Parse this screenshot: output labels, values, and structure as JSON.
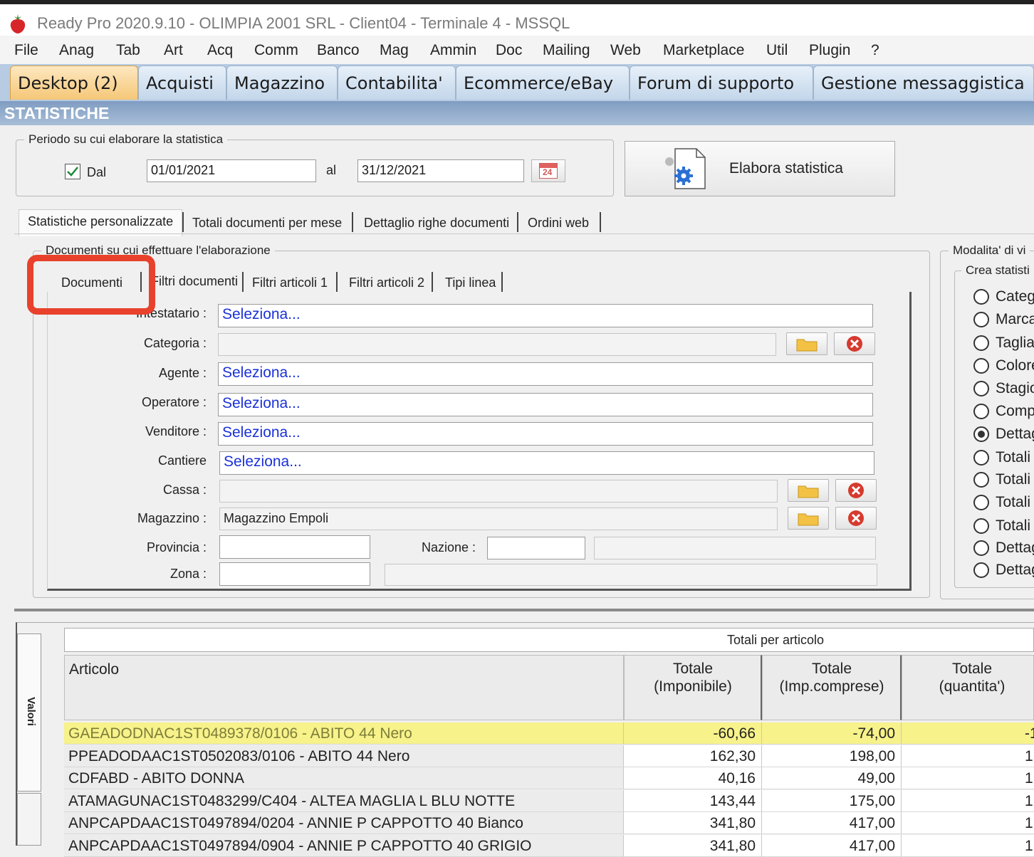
{
  "window": {
    "title": "Ready Pro 2020.9.10 - OLIMPIA 2001 SRL - Client04 - Terminale 4 - MSSQL"
  },
  "menu": [
    "File",
    "Anag",
    "Tab",
    "Art",
    "Acq",
    "Comm",
    "Banco",
    "Mag",
    "Ammin",
    "Doc",
    "Mailing",
    "Web",
    "Marketplace",
    "Util",
    "Plugin",
    "?"
  ],
  "main_tabs": [
    "Desktop (2)",
    "Acquisti",
    "Magazzino",
    "Contabilita'",
    "Ecommerce/eBay",
    "Forum di supporto",
    "Gestione messaggistica"
  ],
  "section_title": "STATISTICHE",
  "period": {
    "legend": "Periodo su cui elaborare la statistica",
    "dal_label": "Dal",
    "dal_checked": true,
    "from": "01/01/2021",
    "al_label": "al",
    "to": "31/12/2021",
    "calendar_day": "24"
  },
  "elabora_button": "Elabora statistica",
  "stat_tabs": [
    "Statistiche personalizzate",
    "Totali documenti per mese",
    "Dettaglio righe documenti",
    "Ordini web"
  ],
  "documents_group": {
    "legend": "Documenti su cui effettuare l'elaborazione",
    "tabs": [
      "Documenti",
      "Filtri documenti",
      "Filtri articoli 1",
      "Filtri articoli 2",
      "Tipi linea"
    ]
  },
  "filters": {
    "intestatario_label": "Intestatario :",
    "intestatario": "Seleziona...",
    "categoria_label": "Categoria :",
    "categoria": "",
    "agente_label": "Agente :",
    "agente": "Seleziona...",
    "operatore_label": "Operatore :",
    "operatore": "Seleziona...",
    "venditore_label": "Venditore :",
    "venditore": "Seleziona...",
    "cantiere_label": "Cantiere",
    "cantiere": "Seleziona...",
    "cassa_label": "Cassa :",
    "cassa": "",
    "magazzino_label": "Magazzino :",
    "magazzino": "Magazzino Empoli",
    "provincia_label": "Provincia :",
    "provincia": "",
    "nazione_label": "Nazione :",
    "nazione": "",
    "zona_label": "Zona :",
    "zona": ""
  },
  "mode_group": {
    "legend": "Modalita' di vi",
    "sublegend": "Crea statisti",
    "options": [
      "Categ",
      "Marca",
      "Taglia",
      "Colore",
      "Stagio",
      "Comp",
      "Dettag",
      "Totali",
      "Totali",
      "Totali",
      "Totali",
      "Dettag",
      "Dettag"
    ],
    "selected_index": 6
  },
  "side_tab": "Valori",
  "table": {
    "group_header": "Totali per articolo",
    "columns": [
      "Articolo",
      "Totale\n(Imponibile)",
      "Totale\n(Imp.comprese)",
      "Totale\n(quantita')"
    ],
    "rows": [
      {
        "articolo": "GAEADODNAC1ST0489378/0106 - ABITO 44 Nero",
        "imponibile": "-60,66",
        "imp_comprese": "-74,00",
        "quantita": "-1",
        "highlight": true
      },
      {
        "articolo": "PPEADODAAC1ST0502083/0106 - ABITO 44 Nero",
        "imponibile": "162,30",
        "imp_comprese": "198,00",
        "quantita": "1"
      },
      {
        "articolo": "CDFABD - ABITO DONNA",
        "imponibile": "40,16",
        "imp_comprese": "49,00",
        "quantita": "1"
      },
      {
        "articolo": "ATAMAGUNAC1ST0483299/C404 - ALTEA MAGLIA L BLU NOTTE",
        "imponibile": "143,44",
        "imp_comprese": "175,00",
        "quantita": "1"
      },
      {
        "articolo": "ANPCAPDAAC1ST0497894/0204 - ANNIE P CAPPOTTO 40 Bianco",
        "imponibile": "341,80",
        "imp_comprese": "417,00",
        "quantita": "1"
      },
      {
        "articolo": "ANPCAPDAAC1ST0497894/0904 - ANNIE P CAPPOTTO 40 GRIGIO",
        "imponibile": "341,80",
        "imp_comprese": "417,00",
        "quantita": "1"
      }
    ]
  },
  "colors": {
    "highlight": "#f7f28a",
    "annotation": "#e8412c",
    "link": "#1a31d8",
    "section": "#7f9cc1"
  }
}
